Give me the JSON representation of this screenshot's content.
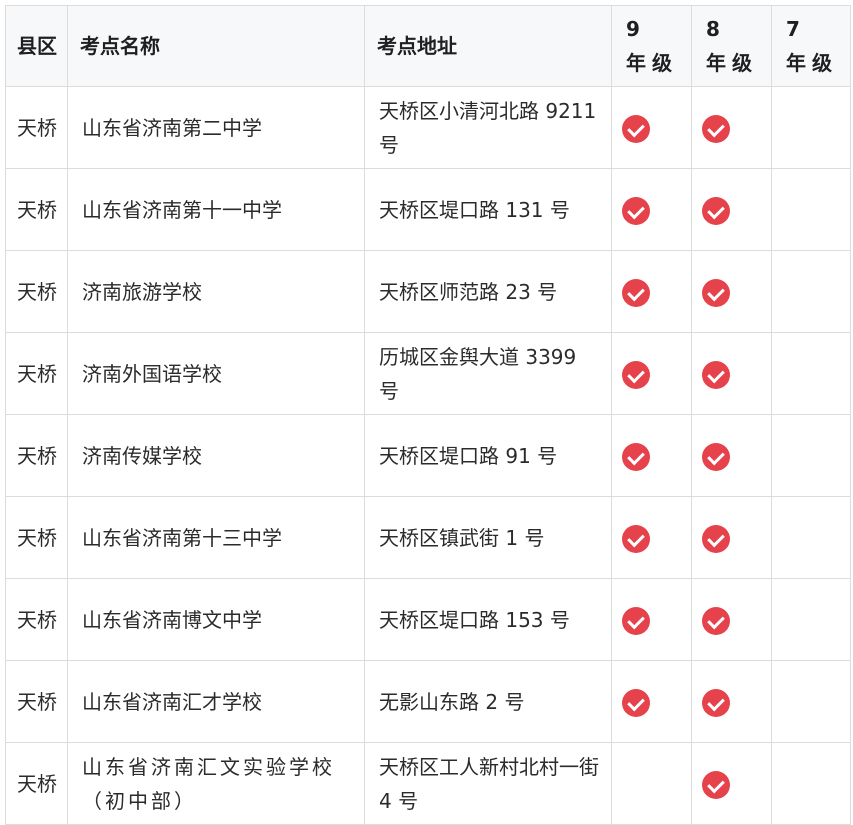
{
  "headers": {
    "district": "县区",
    "name": "考点名称",
    "address": "考点地址",
    "grade9": "9 年级",
    "grade8": "8 年级",
    "grade7": "7 年级"
  },
  "rows": [
    {
      "district": "天桥",
      "name": "山东省济南第二中学",
      "address": "天桥区小清河北路 9211 号",
      "grade9": true,
      "grade8": true,
      "grade7": false
    },
    {
      "district": "天桥",
      "name": "山东省济南第十一中学",
      "address": "天桥区堤口路 131 号",
      "grade9": true,
      "grade8": true,
      "grade7": false
    },
    {
      "district": "天桥",
      "name": "济南旅游学校",
      "address": "天桥区师范路 23 号",
      "grade9": true,
      "grade8": true,
      "grade7": false
    },
    {
      "district": "天桥",
      "name": "济南外国语学校",
      "address": "历城区金舆大道 3399 号",
      "grade9": true,
      "grade8": true,
      "grade7": false
    },
    {
      "district": "天桥",
      "name": "济南传媒学校",
      "address": "天桥区堤口路 91 号",
      "grade9": true,
      "grade8": true,
      "grade7": false
    },
    {
      "district": "天桥",
      "name": "山东省济南第十三中学",
      "address": "天桥区镇武街 1 号",
      "grade9": true,
      "grade8": true,
      "grade7": false
    },
    {
      "district": "天桥",
      "name": "山东省济南博文中学",
      "address": "天桥区堤口路 153 号",
      "grade9": true,
      "grade8": true,
      "grade7": false
    },
    {
      "district": "天桥",
      "name": "山东省济南汇才学校",
      "address": "无影山东路 2 号",
      "grade9": true,
      "grade8": true,
      "grade7": false
    },
    {
      "district": "天桥",
      "name": "山东省济南汇文实验学校（初中部）",
      "address": "天桥区工人新村北村一街 4 号",
      "grade9": false,
      "grade8": true,
      "grade7": false
    }
  ],
  "icons": {
    "check": "check-circle-icon",
    "check_color": "#e6424b"
  }
}
